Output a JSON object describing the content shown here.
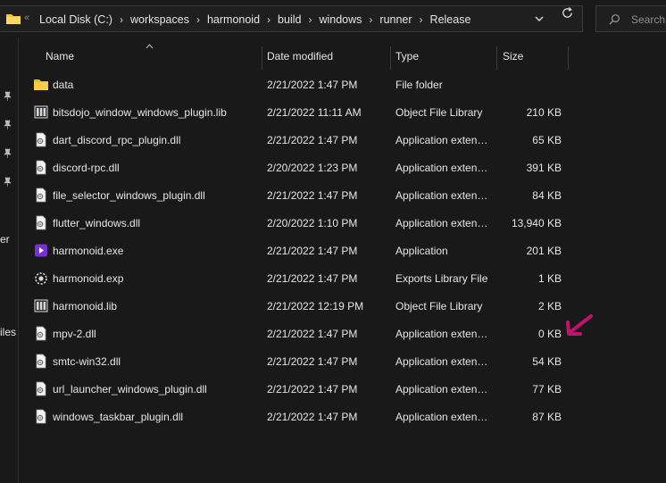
{
  "address_bar": {
    "crumbs": [
      "Local Disk (C:)",
      "workspaces",
      "harmonoid",
      "build",
      "windows",
      "runner",
      "Release"
    ]
  },
  "search": {
    "placeholder": "Search"
  },
  "nav_pane": {
    "fragments": [
      "er",
      "iles"
    ]
  },
  "columns": {
    "name": "Name",
    "date": "Date modified",
    "type": "Type",
    "size": "Size"
  },
  "files": [
    {
      "name": "data",
      "date": "2/21/2022 1:47 PM",
      "type": "File folder",
      "size": "",
      "icon": "folder-icon"
    },
    {
      "name": "bitsdojo_window_windows_plugin.lib",
      "date": "2/21/2022 11:11 AM",
      "type": "Object File Library",
      "size": "210 KB",
      "icon": "library-file-icon"
    },
    {
      "name": "dart_discord_rpc_plugin.dll",
      "date": "2/21/2022 1:47 PM",
      "type": "Application exten…",
      "size": "65 KB",
      "icon": "dll-file-icon"
    },
    {
      "name": "discord-rpc.dll",
      "date": "2/20/2022 1:23 PM",
      "type": "Application exten…",
      "size": "391 KB",
      "icon": "dll-file-icon"
    },
    {
      "name": "file_selector_windows_plugin.dll",
      "date": "2/21/2022 1:47 PM",
      "type": "Application exten…",
      "size": "84 KB",
      "icon": "dll-file-icon"
    },
    {
      "name": "flutter_windows.dll",
      "date": "2/20/2022 1:10 PM",
      "type": "Application exten…",
      "size": "13,940 KB",
      "icon": "dll-file-icon"
    },
    {
      "name": "harmonoid.exe",
      "date": "2/21/2022 1:47 PM",
      "type": "Application",
      "size": "201 KB",
      "icon": "app-icon"
    },
    {
      "name": "harmonoid.exp",
      "date": "2/21/2022 1:47 PM",
      "type": "Exports Library File",
      "size": "1 KB",
      "icon": "exp-file-icon"
    },
    {
      "name": "harmonoid.lib",
      "date": "2/21/2022 12:19 PM",
      "type": "Object File Library",
      "size": "2 KB",
      "icon": "library-file-icon"
    },
    {
      "name": "mpv-2.dll",
      "date": "2/21/2022 1:47 PM",
      "type": "Application exten…",
      "size": "0 KB",
      "icon": "dll-file-icon"
    },
    {
      "name": "smtc-win32.dll",
      "date": "2/21/2022 1:47 PM",
      "type": "Application exten…",
      "size": "54 KB",
      "icon": "dll-file-icon"
    },
    {
      "name": "url_launcher_windows_plugin.dll",
      "date": "2/21/2022 1:47 PM",
      "type": "Application exten…",
      "size": "77 KB",
      "icon": "dll-file-icon"
    },
    {
      "name": "windows_taskbar_plugin.dll",
      "date": "2/21/2022 1:47 PM",
      "type": "Application exten…",
      "size": "87 KB",
      "icon": "dll-file-icon"
    }
  ],
  "colors": {
    "background": "#191919",
    "folder": "#f4c542",
    "app_icon": "#7b2fd6",
    "annotation_arrow": "#c2126b"
  }
}
